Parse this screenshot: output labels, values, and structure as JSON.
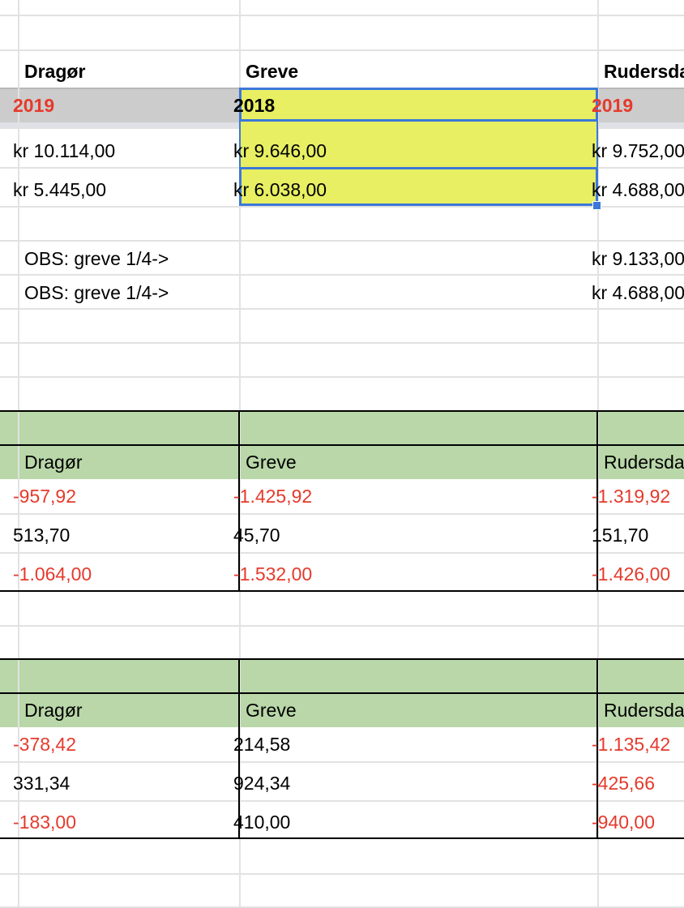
{
  "columns": {
    "a": "Dragør",
    "b": "Greve",
    "c": "Rudersdal"
  },
  "header_row": {
    "a": "2019",
    "b": "2018",
    "c": "2019"
  },
  "price_rows": [
    {
      "a": "kr 10.114,00",
      "b": "kr 9.646,00",
      "c": "kr 9.752,00"
    },
    {
      "a": "kr 5.445,00",
      "b": "kr 6.038,00",
      "c": "kr 4.688,00"
    }
  ],
  "obs_rows": [
    {
      "a": "OBS: greve 1/4->",
      "c": "kr 9.133,00"
    },
    {
      "a": "OBS: greve 1/4->",
      "c": "kr 4.688,00"
    }
  ],
  "table1": {
    "headers": {
      "a": "Dragør",
      "b": "Greve",
      "c": "Rudersdal"
    },
    "rows": [
      {
        "a": "-957,92",
        "b": "-1.425,92",
        "c": "-1.319,92"
      },
      {
        "a": "513,70",
        "b": "45,70",
        "c": "151,70"
      },
      {
        "a": "-1.064,00",
        "b": "-1.532,00",
        "c": "-1.426,00"
      }
    ]
  },
  "table2": {
    "headers": {
      "a": "Dragør",
      "b": "Greve",
      "c": "Rudersdal"
    },
    "rows": [
      {
        "a": "-378,42",
        "b": "214,58",
        "c": "-1.135,42"
      },
      {
        "a": "331,34",
        "b": "924,34",
        "c": "-425,66"
      },
      {
        "a": "-183,00",
        "b": "410,00",
        "c": "-940,00"
      }
    ]
  },
  "colors": {
    "accent_red": "#e53a2c",
    "selection_fill": "#e8ef62",
    "selection_border": "#3c78d8",
    "table_header_green": "#b9d7a8",
    "header_row_gray": "#cccccc"
  }
}
